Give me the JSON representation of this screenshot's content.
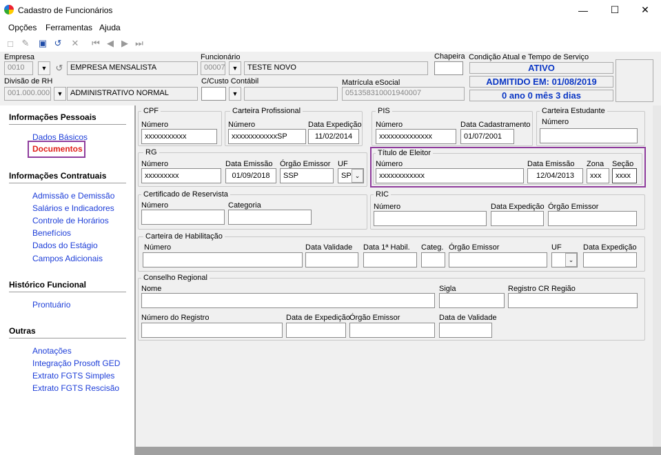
{
  "window": {
    "title": "Cadastro de Funcionários",
    "minimize": "—",
    "maximize": "☐",
    "close": "✕"
  },
  "menu": [
    {
      "label": "Opções"
    },
    {
      "label": "Ferramentas"
    },
    {
      "label": "Ajuda"
    }
  ],
  "header": {
    "empresa_label": "Empresa",
    "empresa_code": "0010",
    "empresa_name": "EMPRESA MENSALISTA",
    "funcionario_label": "Funcionário",
    "funcionario_code": "00007",
    "funcionario_name": "TESTE NOVO",
    "chapeira_label": "Chapeira",
    "chapeira_value": "",
    "divisao_label": "Divisão de RH",
    "divisao_code": "001.000.000",
    "divisao_name": "ADMINISTRATIVO NORMAL",
    "ccusto_label": "C/Custo Contábil",
    "matricula_label": "Matrícula eSocial",
    "matricula_value": "051358310001940007",
    "condicao_label": "Condição Atual e Tempo de Serviço",
    "status": "ATIVO",
    "admitido": "ADMITIDO EM: 01/08/2019",
    "tempo": "0 ano 0 mês 3 dias"
  },
  "sidebar": {
    "sections": [
      {
        "title": "Informações Pessoais",
        "items": [
          "Dados Básicos",
          "Documentos"
        ]
      },
      {
        "title": "Informações Contratuais",
        "items": [
          "Admissão e Demissão",
          "Salários e Indicadores",
          "Controle de Horários",
          "Benefícios",
          "Dados do Estágio",
          "Campos Adicionais"
        ]
      },
      {
        "title": "Histórico Funcional",
        "items": [
          "Prontuário"
        ]
      },
      {
        "title": "Outras",
        "items": [
          "Anotações",
          "Integração Prosoft GED",
          "Extrato FGTS Simples",
          "Extrato FGTS Rescisão"
        ]
      }
    ],
    "active": "Documentos"
  },
  "form": {
    "cpf": {
      "title": "CPF",
      "numero_label": "Número",
      "numero": "xxxxxxxxxxx"
    },
    "ctps": {
      "title": "Carteira Profissional",
      "numero_label": "Número",
      "numero": "xxxxxxxxxxxxSP",
      "data_label": "Data Expedição",
      "data": "11/02/2014"
    },
    "pis": {
      "title": "PIS",
      "numero_label": "Número",
      "numero": "xxxxxxxxxxxxxx",
      "data_label": "Data Cadastramento",
      "data": "01/07/2001"
    },
    "estudante": {
      "title": "Carteira Estudante",
      "numero_label": "Número",
      "numero": ""
    },
    "rg": {
      "title": "RG",
      "numero_label": "Número",
      "numero": "xxxxxxxxx",
      "data_label": "Data Emissão",
      "data": "01/09/2018",
      "orgao_label": "Órgão Emissor",
      "orgao": "SSP",
      "uf_label": "UF",
      "uf": "SP"
    },
    "titulo": {
      "title": "Título de Eleitor",
      "numero_label": "Número",
      "numero": "xxxxxxxxxxxx",
      "data_label": "Data Emissão",
      "data": "12/04/2013",
      "zona_label": "Zona",
      "zona": "xxx",
      "secao_label": "Seção",
      "secao": "xxxx"
    },
    "reservista": {
      "title": "Certificado de Reservista",
      "numero_label": "Número",
      "categoria_label": "Categoria"
    },
    "ric": {
      "title": "RIC",
      "numero_label": "Número",
      "data_label": "Data Expedição",
      "orgao_label": "Órgão Emissor"
    },
    "cnh": {
      "title": "Carteira de Habilitação",
      "numero_label": "Número",
      "validade_label": "Data Validade",
      "habil_label": "Data 1ª Habil.",
      "categ_label": "Categ.",
      "orgao_label": "Órgão Emissor",
      "uf_label": "UF",
      "exped_label": "Data Expedição"
    },
    "conselho": {
      "title": "Conselho Regional",
      "nome_label": "Nome",
      "sigla_label": "Sigla",
      "regiao_label": "Registro CR Região",
      "registro_label": "Número do Registro",
      "exped_label": "Data de Expedição",
      "orgao_label": "Órgão Emissor",
      "validade_label": "Data de Validade"
    }
  }
}
